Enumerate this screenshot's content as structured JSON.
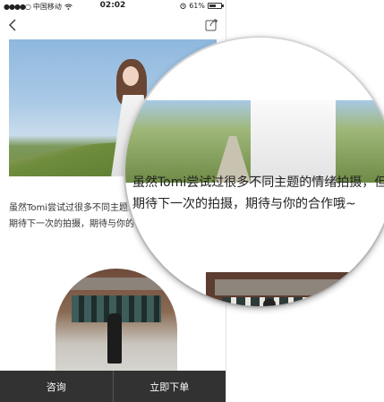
{
  "status_bar": {
    "signal_dots": "●●●●○",
    "carrier": "中国移动",
    "time": "02:02",
    "battery_percent": "61%",
    "battery_level": 0.61
  },
  "content": {
    "caption_line1": "虽然Tomi尝试过很多不同主题的情绪拍摄，但是",
    "caption_line2": "期待下一次的拍摄，期待与你的合作哦~"
  },
  "magnifier": {
    "line1": "虽然Tomi尝试过很多不同主题的情绪拍摄，但是，",
    "line2": "期待下一次的拍摄，期待与你的合作哦~"
  },
  "bottom_bar": {
    "consult_label": "咨询",
    "order_label": "立即下单"
  },
  "icons": {
    "back": "chevron-left-icon",
    "share": "share-icon",
    "wifi": "wifi-icon",
    "alarm": "alarm-icon"
  }
}
